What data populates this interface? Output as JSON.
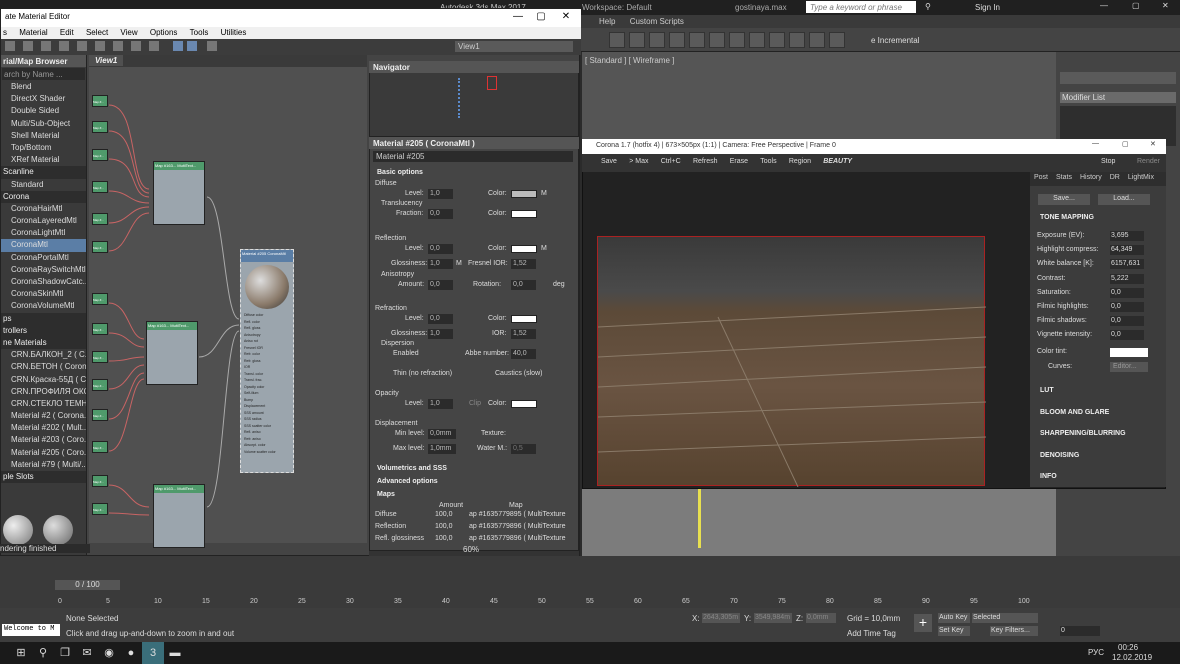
{
  "max_window": {
    "title": "Autodesk 3ds Max 2017",
    "workspace": "Workspace: Default",
    "file": "gostinaya.max",
    "search_placeholder": "Type a keyword or phrase",
    "signin": "Sign In"
  },
  "max_menu": [
    "Help",
    "Custom Scripts"
  ],
  "max_toolbar": {
    "incremental": "e Incremental"
  },
  "viewport": {
    "label": "[ Standard ] [ Wireframe ]"
  },
  "cmdpanel": {
    "modifier_list": "Modifier List"
  },
  "sme": {
    "title": "ate Material Editor",
    "menu": [
      "Material",
      "Edit",
      "Select",
      "View",
      "Options",
      "Tools",
      "Utilities"
    ],
    "view_selector": "View1",
    "browser_title": "rial/Map Browser",
    "browser_search": "arch by Name ...",
    "view_tab": "View1",
    "browser": [
      {
        "t": "i",
        "label": "Blend"
      },
      {
        "t": "i",
        "label": "DirectX Shader"
      },
      {
        "t": "i",
        "label": "Double Sided"
      },
      {
        "t": "i",
        "label": "Multi/Sub-Object"
      },
      {
        "t": "i",
        "label": "Shell Material"
      },
      {
        "t": "i",
        "label": "Top/Bottom"
      },
      {
        "t": "i",
        "label": "XRef Material"
      },
      {
        "t": "h",
        "label": "Scanline"
      },
      {
        "t": "i",
        "label": "Standard"
      },
      {
        "t": "h",
        "label": "Corona"
      },
      {
        "t": "i",
        "label": "CoronaHairMtl"
      },
      {
        "t": "i",
        "label": "CoronaLayeredMtl"
      },
      {
        "t": "i",
        "label": "CoronaLightMtl"
      },
      {
        "t": "s",
        "label": "CoronaMtl"
      },
      {
        "t": "i",
        "label": "CoronaPortalMtl"
      },
      {
        "t": "i",
        "label": "CoronaRaySwitchMtl"
      },
      {
        "t": "i",
        "label": "CoronaShadowCatc..."
      },
      {
        "t": "i",
        "label": "CoronaSkinMtl"
      },
      {
        "t": "i",
        "label": "CoronaVolumeMtl"
      },
      {
        "t": "h",
        "label": "ps"
      },
      {
        "t": "h",
        "label": "trollers"
      },
      {
        "t": "h",
        "label": "ne Materials"
      },
      {
        "t": "i",
        "label": "CRN.БАЛКОН_2  ( C..."
      },
      {
        "t": "i",
        "label": "CRN.БЕТОН  ( Coron..."
      },
      {
        "t": "i",
        "label": "CRN.Краска-55Д  ( C..."
      },
      {
        "t": "i",
        "label": "CRN.ПРОФИЛЯ ОКО..."
      },
      {
        "t": "i",
        "label": "CRN.СТЕКЛО  ТЕМНО..."
      },
      {
        "t": "i",
        "label": "Material #2  ( Corona..."
      },
      {
        "t": "i",
        "label": "Material #202  ( Mult..."
      },
      {
        "t": "i",
        "label": "Material #203  ( Coro..."
      },
      {
        "t": "i",
        "label": "Material #205  ( Coro..."
      },
      {
        "t": "i",
        "label": "Material #79  ( Multi/..."
      },
      {
        "t": "h",
        "label": "ple Slots"
      }
    ],
    "status": "ndering finished",
    "zoom": "60%"
  },
  "nodes": {
    "stub_label": "Map #...",
    "multitex_title": "Map #163...\nMultiText...",
    "material_title": "Material #205\nCoronaMtl",
    "mat_slots": [
      "Diffuse color",
      "Refl. color",
      "Refl. gloss",
      "Anisotropy",
      "Aniso rot",
      "Fresnel IOR",
      "Refr. color",
      "Refr. gloss",
      "IOR",
      "Transl. color",
      "Transl. frac.",
      "Opacity color",
      "Self-illum",
      "Bump",
      "Displacement",
      "SSS amount",
      "SSS radius",
      "SSS scatter color",
      "Refl. aniso",
      "Refr. aniso",
      "Absorpt. color",
      "Volume scatter color"
    ]
  },
  "navigator": {
    "title": "Navigator"
  },
  "params": {
    "title": "Material #205  ( CoronaMtl )",
    "name_field": "Material #205",
    "basic_options": "Basic options",
    "diffuse": "Diffuse",
    "level": "Level:",
    "color": "Color:",
    "translucency": "Translucency",
    "fraction": "Fraction:",
    "reflection": "Reflection",
    "glossiness": "Glossiness:",
    "fresnel_ior": "Fresnel IOR:",
    "anisotropy": "Anisotropy",
    "amount": "Amount:",
    "rotation": "Rotation:",
    "deg": "deg",
    "refraction": "Refraction",
    "ior": "IOR:",
    "dispersion": "Dispersion",
    "enabled": "Enabled",
    "abbe": "Abbe number:",
    "thin": "Thin (no refraction)",
    "caustics": "Caustics (slow)",
    "opacity": "Opacity",
    "clip": "Clip",
    "displacement": "Displacement",
    "min_level": "Min level:",
    "max_level": "Max level:",
    "texture": "Texture:",
    "water": "Water M.:",
    "volumetrics": "Volumetrics and SSS",
    "advanced": "Advanced options",
    "maps": "Maps",
    "maps_amount": "Amount",
    "maps_map": "Map",
    "v_1": "1,0",
    "v_0": "0,0",
    "v_ior": "1,52",
    "v_abbe": "40,0",
    "v_min": "0,0mm",
    "v_max": "1,0mm",
    "v_water": "0,5",
    "m": "M",
    "map_rows": [
      {
        "name": "Diffuse",
        "amount": "100,0",
        "map": "ap #1635779895  ( MultiTexture"
      },
      {
        "name": "Reflection",
        "amount": "100,0",
        "map": "ap #1635779896  ( MultiTexture"
      },
      {
        "name": "Refl. glossiness",
        "amount": "100,0",
        "map": "ap #1635779896  ( MultiTexture"
      }
    ]
  },
  "vfb": {
    "title": "Corona 1.7 (hotfix 4) | 673×505px (1:1) | Camera: Free Perspective | Frame 0",
    "toolbar": [
      "Save",
      "> Max",
      "Ctrl+C",
      "Refresh",
      "Erase",
      "Tools",
      "Region",
      "BEAUTY"
    ],
    "stop": "Stop",
    "render": "Render",
    "tabs": [
      "Post",
      "Stats",
      "History",
      "DR",
      "LightMix"
    ],
    "save_btn": "Save...",
    "load_btn": "Load...",
    "tone_mapping": "TONE MAPPING",
    "rows": [
      {
        "label": "Exposure (EV):",
        "value": "3,695"
      },
      {
        "label": "Highlight compress:",
        "value": "64,349"
      },
      {
        "label": "White balance [K]:",
        "value": "6157,631"
      },
      {
        "label": "Contrast:",
        "value": "5,222"
      },
      {
        "label": "Saturation:",
        "value": "0,0"
      },
      {
        "label": "Filmic highlights:",
        "value": "0,0"
      },
      {
        "label": "Filmic shadows:",
        "value": "0,0"
      },
      {
        "label": "Vignette intensity:",
        "value": "0,0"
      }
    ],
    "color_tint": "Color tint:",
    "curves": "Curves:",
    "editor": "Editor...",
    "sections": [
      "LUT",
      "BLOOM AND GLARE",
      "SHARPENING/BLURRING",
      "DENOISING",
      "INFO"
    ]
  },
  "timeline": {
    "frame": "0 / 100",
    "ticks": [
      "0",
      "5",
      "10",
      "15",
      "20",
      "25",
      "30",
      "35",
      "40",
      "45",
      "50",
      "55",
      "60",
      "65",
      "70",
      "75",
      "80",
      "85",
      "90",
      "95",
      "100"
    ]
  },
  "status": {
    "script": "Welcome to M",
    "selected": "None Selected",
    "prompt": "Click and drag up-and-down to zoom in and out",
    "x_label": "X:",
    "x_val": "2643,305m",
    "y_label": "Y:",
    "y_val": "3549,984m",
    "z_label": "Z:",
    "z_val": "0,0mm",
    "grid": "Grid = 10,0mm",
    "add_time_tag": "Add Time Tag",
    "autokey": "Auto Key",
    "setkey": "Set Key",
    "selected_dd": "Selected",
    "keyfilters": "Key Filters...",
    "frame_spinner": "0"
  },
  "taskbar": {
    "lang": "РУС",
    "time": "00:26",
    "date": "12.02.2019"
  }
}
